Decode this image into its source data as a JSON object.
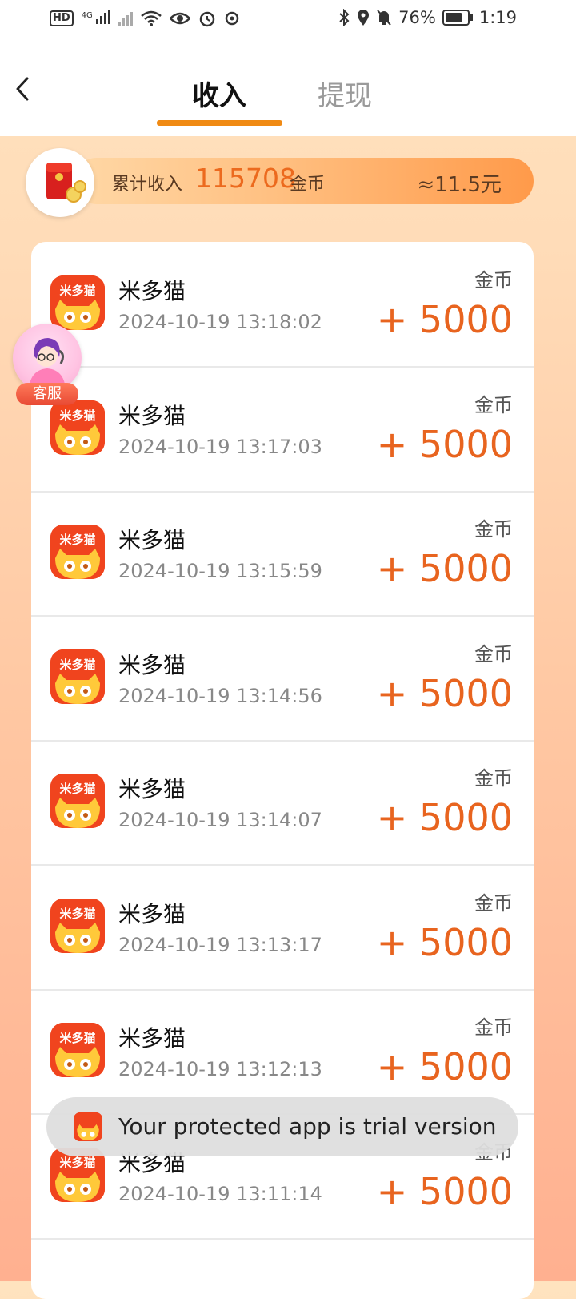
{
  "status_bar": {
    "hd_label": "HD",
    "network_label": "4G",
    "battery_percent": "76%",
    "time": "1:19"
  },
  "header": {
    "tabs": [
      {
        "label": "收入",
        "active": true
      },
      {
        "label": "提现",
        "active": false
      }
    ]
  },
  "summary": {
    "label": "累计收入",
    "value": "115708",
    "unit": "金币",
    "rmb": "≈11.5元"
  },
  "service_button": {
    "label": "客服"
  },
  "records": [
    {
      "app": "米多猫",
      "time": "2024-10-19 13:18:02",
      "unit": "金币",
      "amount": "+ 5000"
    },
    {
      "app": "米多猫",
      "time": "2024-10-19 13:17:03",
      "unit": "金币",
      "amount": "+ 5000"
    },
    {
      "app": "米多猫",
      "time": "2024-10-19 13:15:59",
      "unit": "金币",
      "amount": "+ 5000"
    },
    {
      "app": "米多猫",
      "time": "2024-10-19 13:14:56",
      "unit": "金币",
      "amount": "+ 5000"
    },
    {
      "app": "米多猫",
      "time": "2024-10-19 13:14:07",
      "unit": "金币",
      "amount": "+ 5000"
    },
    {
      "app": "米多猫",
      "time": "2024-10-19 13:13:17",
      "unit": "金币",
      "amount": "+ 5000"
    },
    {
      "app": "米多猫",
      "time": "2024-10-19 13:12:13",
      "unit": "金币",
      "amount": "+ 5000"
    },
    {
      "app": "米多猫",
      "time": "2024-10-19 13:11:14",
      "unit": "金币",
      "amount": "+ 5000"
    }
  ],
  "app_icon_text": "米多猫",
  "toast": {
    "text": "Your protected app is trial version"
  },
  "colors": {
    "accent": "#f08a14",
    "amount": "#e8641f",
    "icon_bg": "#f0441e"
  }
}
